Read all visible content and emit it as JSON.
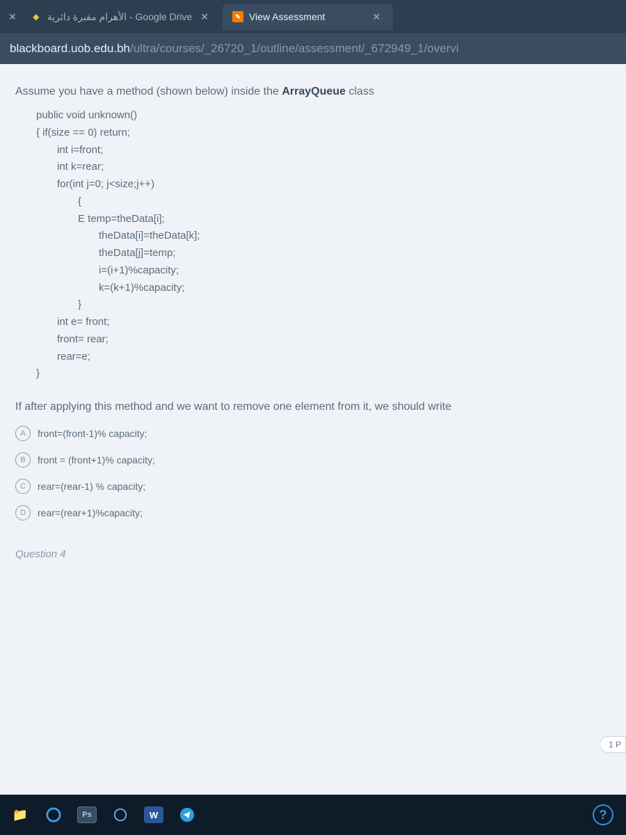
{
  "tabs": [
    {
      "label": "الأهرام مقبرة دائرية",
      "suffix": " - Google Drive",
      "active": false,
      "favicon": "g"
    },
    {
      "label": "View Assessment",
      "suffix": "",
      "active": true,
      "favicon": "bb"
    }
  ],
  "url": {
    "host": "blackboard.uob.edu.bh",
    "path": "/ultra/courses/_26720_1/outline/assessment/_672949_1/overvi"
  },
  "question": {
    "prompt_pre": "Assume you have a method (shown below) inside the ",
    "prompt_class": "ArrayQueue",
    "prompt_post": " class",
    "code": [
      {
        "ind": "l0",
        "t": "public void unknown()"
      },
      {
        "ind": "l0",
        "t": "{   if(size == 0) return;"
      },
      {
        "ind": "l2",
        "t": "int i=front;"
      },
      {
        "ind": "l2",
        "t": "int k=rear;"
      },
      {
        "ind": "l2",
        "t": "for(int j=0; j<size;j++)"
      },
      {
        "ind": "l3",
        "t": "{"
      },
      {
        "ind": "l3",
        "t": "  E temp=theData[i];"
      },
      {
        "ind": "l4",
        "t": "theData[i]=theData[k];"
      },
      {
        "ind": "l4",
        "t": "theData[j]=temp;"
      },
      {
        "ind": "l4",
        "t": "i=(i+1)%capacity;"
      },
      {
        "ind": "l4",
        "t": "k=(k+1)%capacity;"
      },
      {
        "ind": "l3",
        "t": "}"
      },
      {
        "ind": "l2",
        "t": "int e= front;"
      },
      {
        "ind": "l2",
        "t": "front= rear;"
      },
      {
        "ind": "l2",
        "t": "rear=e;"
      },
      {
        "ind": "l1",
        "t": "}"
      }
    ],
    "followup": "If after applying this method and we want to remove one element from it, we should write",
    "options": [
      {
        "letter": "A",
        "text": "front=(front-1)% capacity;"
      },
      {
        "letter": "B",
        "text": "front = (front+1)% capacity;"
      },
      {
        "letter": "C",
        "text": "rear=(rear-1) % capacity;"
      },
      {
        "letter": "D",
        "text": "rear=(rear+1)%capacity;"
      }
    ]
  },
  "next_question": "Question 4",
  "pill": "1 P",
  "taskbar": {
    "file": "📁",
    "ps": "Ps",
    "word": "W",
    "help": "?"
  }
}
